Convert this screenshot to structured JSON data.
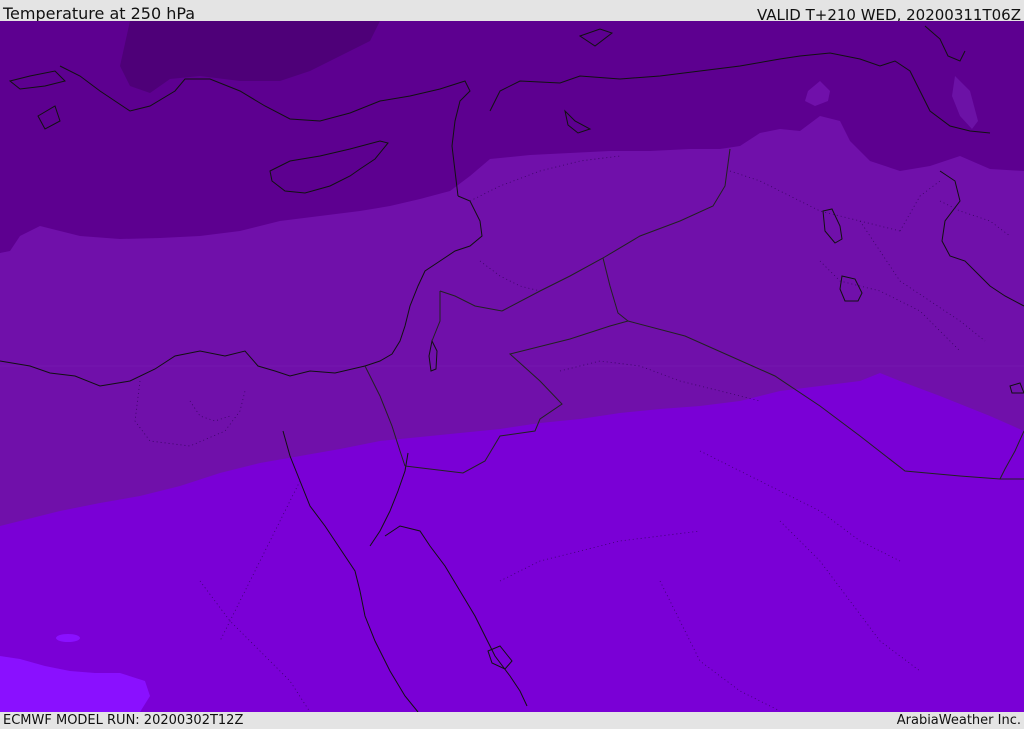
{
  "header": {
    "title": "Temperature at 250 hPa",
    "valid_time": "VALID T+210 WED, 20200311T06Z"
  },
  "footer": {
    "model_run": "ECMWF MODEL RUN: 20200302T12Z",
    "provider": "ArabiaWeather Inc."
  },
  "colors": {
    "band_darkest": "#4e0078",
    "band_dark": "#5d0090",
    "band_mid": "#7010aa",
    "band_mid_low": "#6c12a6",
    "band_light": "#7a00d6",
    "band_lightest": "#8a10ff",
    "coastline": "#111111"
  }
}
